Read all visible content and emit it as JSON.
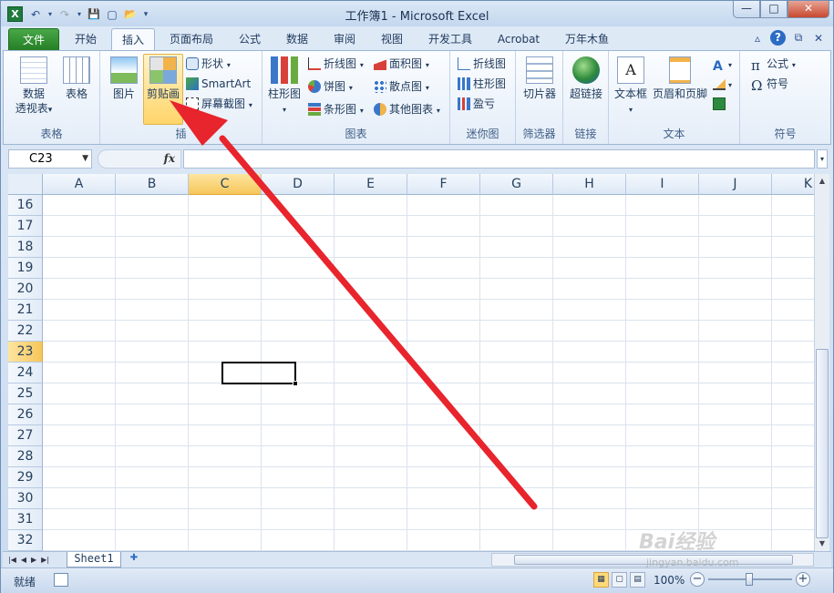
{
  "window": {
    "title": "工作簿1 - Microsoft Excel",
    "app_icon": "X",
    "controls": {
      "minimize": "—",
      "maximize": "□",
      "close": "✕"
    }
  },
  "qat": {
    "undo": "↶",
    "redo": "↷",
    "save": "💾",
    "new": "▢",
    "open": "📂",
    "more": "▾"
  },
  "tabs": [
    {
      "label": "文件"
    },
    {
      "label": "开始"
    },
    {
      "label": "插入"
    },
    {
      "label": "页面布局"
    },
    {
      "label": "公式"
    },
    {
      "label": "数据"
    },
    {
      "label": "审阅"
    },
    {
      "label": "视图"
    },
    {
      "label": "开发工具"
    },
    {
      "label": "Acrobat"
    },
    {
      "label": "万年木鱼"
    }
  ],
  "tab_icons": {
    "collapse": "▵",
    "help": "?",
    "restore": "⧉",
    "close": "✕"
  },
  "ribbon": {
    "tables": {
      "label": "表格",
      "pivot": "数据",
      "pivot2": "透视表",
      "pivot_arrow": "▾",
      "table": "表格"
    },
    "illustrations": {
      "label": "插",
      "picture": "图片",
      "clipart": "剪贴画",
      "shapes": "形状",
      "smartart": "SmartArt",
      "screenshot": "屏幕截图"
    },
    "charts": {
      "label": "图表",
      "column": "柱形图",
      "line": "折线图",
      "pie": "饼图",
      "bar": "条形图",
      "area": "面积图",
      "scatter": "散点图",
      "other": "其他图表"
    },
    "sparklines": {
      "label": "迷你图",
      "line": "折线图",
      "column": "柱形图",
      "winloss": "盈亏"
    },
    "filter": {
      "label": "筛选器",
      "slicer": "切片器"
    },
    "links": {
      "label": "链接",
      "hyperlink": "超链接"
    },
    "text": {
      "label": "文本",
      "textbox": "文本框",
      "headerfooter": "页眉和页脚"
    },
    "symbols": {
      "label": "符号",
      "equation": "公式",
      "symbol": "符号"
    }
  },
  "formula_bar": {
    "name_box": "C23",
    "fx": "fx",
    "formula": ""
  },
  "grid": {
    "columns": [
      "A",
      "B",
      "C",
      "D",
      "E",
      "F",
      "G",
      "H",
      "I",
      "J",
      "K"
    ],
    "rows": [
      "16",
      "17",
      "18",
      "19",
      "20",
      "21",
      "22",
      "23",
      "24",
      "25",
      "26",
      "27",
      "28",
      "29",
      "30",
      "31",
      "32"
    ],
    "selected_column": "C",
    "selected_row": "23"
  },
  "sheet_tabs": {
    "sheet1": "Sheet1"
  },
  "status": {
    "ready": "就绪",
    "zoom": "100%"
  },
  "watermark": {
    "brand": "Bai经验",
    "url": "jingyan.baidu.com"
  },
  "colors": {
    "accent_file": "#2e8b2e",
    "arrow": "#e8242c",
    "selected_header": "#f6c65a"
  }
}
